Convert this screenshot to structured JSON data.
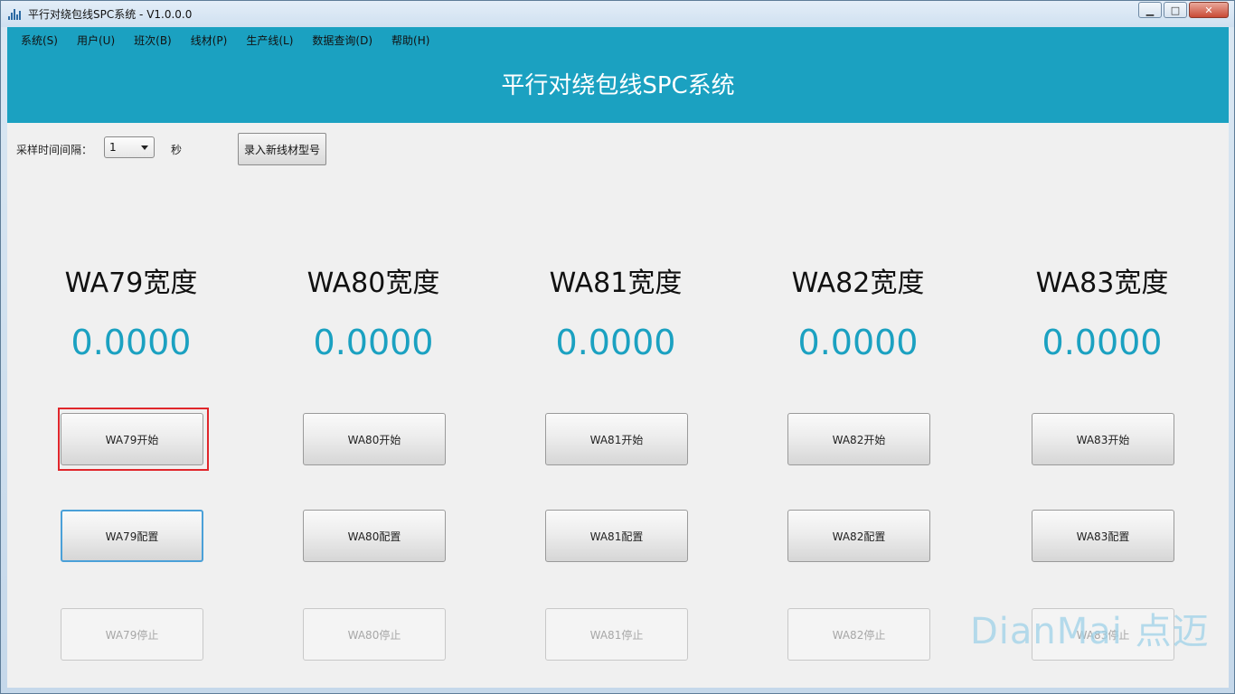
{
  "window": {
    "title": "平行对绕包线SPC系统 - V1.0.0.0",
    "minimize": "▁",
    "maximize": "□",
    "close": "✕"
  },
  "menu": [
    "系统(S)",
    "用户(U)",
    "班次(B)",
    "线材(P)",
    "生产线(L)",
    "数据查询(D)",
    "帮助(H)"
  ],
  "header": {
    "title": "平行对绕包线SPC系统"
  },
  "toolbar": {
    "sample_label": "采样时间间隔：",
    "interval_value": "1",
    "unit_label": "秒",
    "new_model_button": "录入新线材型号"
  },
  "columns": [
    {
      "title": "WA79宽度",
      "value": "0.0000",
      "start": "WA79开始",
      "config": "WA79配置",
      "stop": "WA79停止"
    },
    {
      "title": "WA80宽度",
      "value": "0.0000",
      "start": "WA80开始",
      "config": "WA80配置",
      "stop": "WA80停止"
    },
    {
      "title": "WA81宽度",
      "value": "0.0000",
      "start": "WA81开始",
      "config": "WA81配置",
      "stop": "WA81停止"
    },
    {
      "title": "WA82宽度",
      "value": "0.0000",
      "start": "WA82开始",
      "config": "WA82配置",
      "stop": "WA82停止"
    },
    {
      "title": "WA83宽度",
      "value": "0.0000",
      "start": "WA83开始",
      "config": "WA83配置",
      "stop": "WA83停止"
    }
  ],
  "watermark": "DianMai 点迈",
  "colors": {
    "accent": "#1ba1c1",
    "highlight": "#e0262b"
  }
}
